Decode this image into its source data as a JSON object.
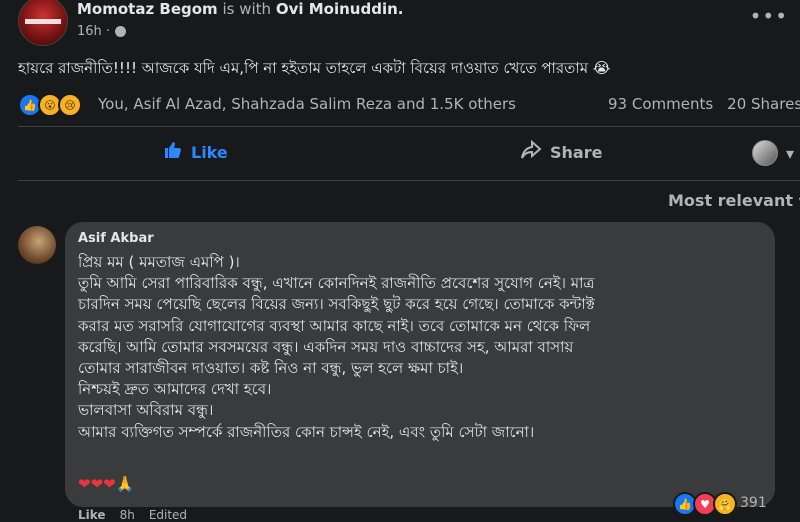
{
  "post": {
    "author": "Momotaz Begom",
    "with_text": "is with",
    "tagged": "Ovi Moinuddin.",
    "time": "16h ·",
    "more_icon": "more-dots-icon",
    "text": "হায়রে রাজনীতি!!!! আজকে যদি এম,পি না হইতাম তাহলে একটা বিয়ের দাওয়াত খেতে পারতাম 😭"
  },
  "reactions": {
    "names": "You, Asif Al Azad, Shahzada Salim Reza and 1.5K others",
    "comments": "93 Comments",
    "shares": "20 Shares"
  },
  "actions": {
    "like": "Like",
    "share": "Share"
  },
  "sort": {
    "label": "Most relevant ▾"
  },
  "comment": {
    "author": "Asif Akbar",
    "lines": [
      "প্রিয় মম ( মমতাজ এমপি )।",
      "তুমি আমি সেরা পারিবারিক বন্ধু, এখানে কোনদিনই রাজনীতি প্রবেশের সুযোগ নেই। মাত্র",
      "চারদিন সময় পেয়েছি ছেলের বিয়ের জন্য। সবকিছুই ছুট করে হয়ে গেছে। তোমাকে কন্টাক্ট",
      "করার মত সরাসরি যোগাযোগের ব্যবস্থা আমার কাছে নাই। তবে তোমাকে মন থেকে ফিল",
      "করেছি। আমি তোমার সবসময়ের বন্ধু। একদিন সময় দাও বাচ্চাদের সহ, আমরা বাসায়",
      "তোমার সারাজীবন দাওয়াত। কষ্ট নিও না বন্ধু, ভুল হলে ক্ষমা চাই।",
      "নিশ্চয়ই দ্রুত আমাদের দেখা হবে।",
      "ভালবাসা অবিরাম বন্ধু।",
      "আমার ব্যক্তিগত সম্পর্কে রাজনীতির কোন চান্সই নেই, এবং তুমি সেটা জানো।"
    ],
    "hearts": "❤❤❤",
    "pray": "🙏",
    "reaction_count": "391",
    "footer_like": "Like",
    "footer_time": "8h",
    "footer_edited": "Edited"
  }
}
